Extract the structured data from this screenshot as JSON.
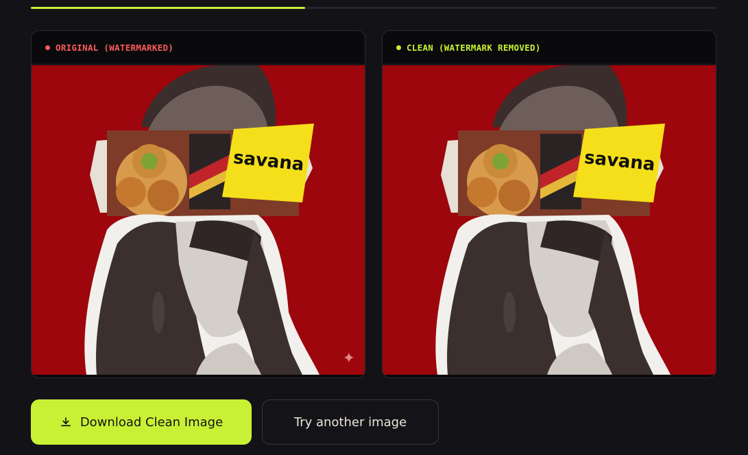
{
  "progress": {
    "fraction": 0.4
  },
  "panels": {
    "original": {
      "label": "ORIGINAL (WATERMARKED)",
      "dot_color": "#ff5a5a",
      "label_color": "#ff5a5a",
      "image_text": "savana"
    },
    "clean": {
      "label": "CLEAN (WATERMARK REMOVED)",
      "dot_color": "#c8f135",
      "label_color": "#c8f135",
      "image_text": "savana"
    }
  },
  "actions": {
    "download_label": "Download Clean Image",
    "try_another_label": "Try another image"
  },
  "colors": {
    "accent": "#c8f135",
    "background": "#131217",
    "image_bg": "#9c060c"
  }
}
